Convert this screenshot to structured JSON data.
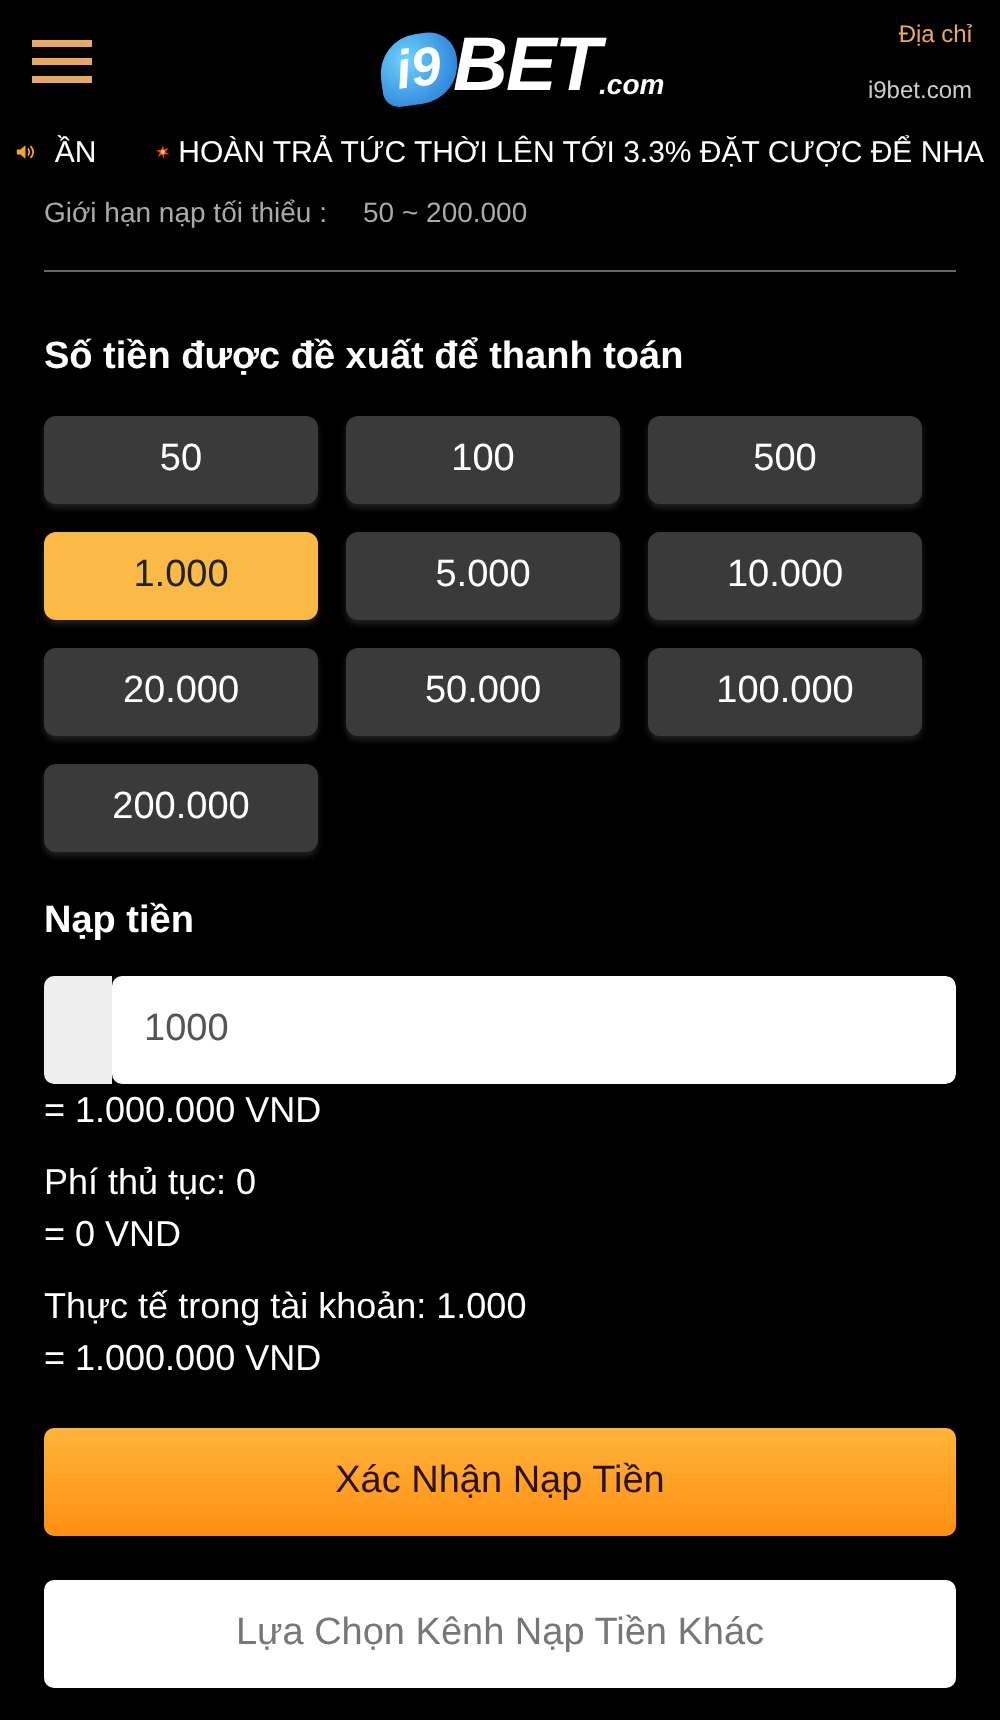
{
  "header": {
    "logo": {
      "badge": "i9",
      "word": "BET",
      "suffix": ".com"
    },
    "address_label": "Địa chỉ",
    "address": "i9bet.com"
  },
  "marquee": {
    "items": [
      "ẦN",
      "HOÀN TRẢ TỨC THỜI LÊN TỚI 3.3% ĐẶT CƯỢC ĐỂ NHA"
    ]
  },
  "limit": {
    "label": "Giới hạn nạp tối thiểu :",
    "value": "50 ~ 200.000"
  },
  "suggested": {
    "title": "Số tiền được đề xuất để thanh toán",
    "amounts": [
      {
        "label": "50",
        "selected": false
      },
      {
        "label": "100",
        "selected": false
      },
      {
        "label": "500",
        "selected": false
      },
      {
        "label": "1.000",
        "selected": true
      },
      {
        "label": "5.000",
        "selected": false
      },
      {
        "label": "10.000",
        "selected": false
      },
      {
        "label": "20.000",
        "selected": false
      },
      {
        "label": "50.000",
        "selected": false
      },
      {
        "label": "100.000",
        "selected": false
      },
      {
        "label": "200.000",
        "selected": false
      }
    ]
  },
  "deposit": {
    "title": "Nạp tiền",
    "value": "1000",
    "converted": "= 1.000.000 VND",
    "fee": "Phí thủ tục: 0",
    "fee_converted": "= 0 VND",
    "actual": "Thực tế trong tài khoản: 1.000",
    "actual_converted": "= 1.000.000 VND"
  },
  "buttons": [
    {
      "label": "Xác Nhận Nạp Tiền",
      "kind": "primary"
    },
    {
      "label": "Lựa Chọn Kênh Nạp Tiền Khác",
      "kind": "secondary"
    }
  ]
}
